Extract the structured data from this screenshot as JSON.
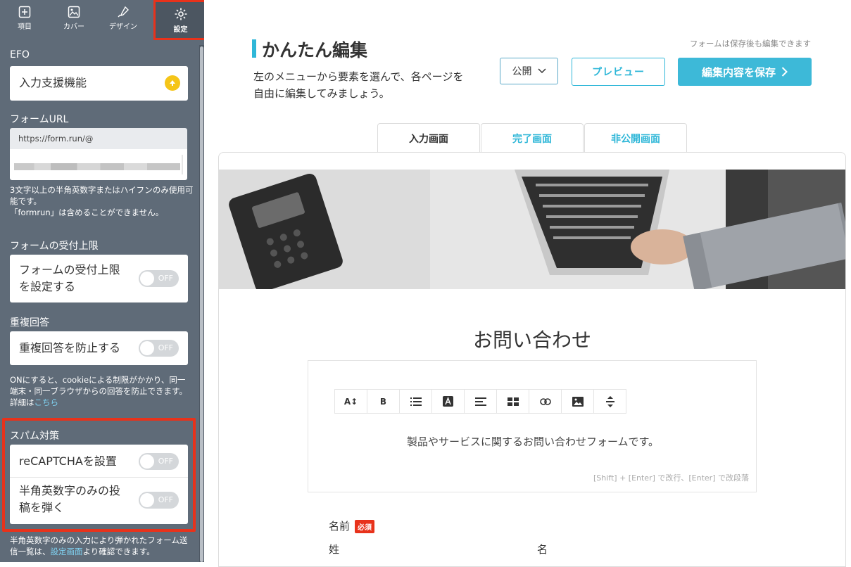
{
  "sidebar": {
    "tabs": [
      {
        "label": "項目",
        "icon": "plus-square-icon"
      },
      {
        "label": "カバー",
        "icon": "image-icon"
      },
      {
        "label": "デザイン",
        "icon": "brush-icon"
      },
      {
        "label": "設定",
        "icon": "gear-icon"
      }
    ],
    "efo": {
      "heading": "EFO",
      "card_label": "入力支援機能"
    },
    "url": {
      "heading": "フォームURL",
      "prefix": "https://form.run/@",
      "note_line1": "3文字以上の半角英数字またはハイフンのみ使用可能です。",
      "note_line2": "「formrun」は含めることができません。"
    },
    "limit": {
      "heading": "フォームの受付上限",
      "label_line1": "フォームの受付上限",
      "label_line2": "を設定する",
      "toggle": "OFF"
    },
    "duplicate": {
      "heading": "重複回答",
      "label": "重複回答を防止する",
      "toggle": "OFF",
      "note": "ONにすると、cookieによる制限がかかり、同一端末・同一ブラウザからの回答を防止できます。詳細は",
      "note_link": "こちら"
    },
    "spam": {
      "heading": "スパム対策",
      "recaptcha_label": "reCAPTCHAを設置",
      "recaptcha_toggle": "OFF",
      "alnum_line1": "半角英数字のみの投",
      "alnum_line2": "稿を弾く",
      "alnum_toggle": "OFF",
      "note_pre": "半角英数字のみの入力により弾かれたフォーム送信一覧は、",
      "note_link": "設定画面",
      "note_post": "より確認できます。"
    }
  },
  "header": {
    "title": "かんたん編集",
    "desc_line1": "左のメニューから要素を選んで、各ページを",
    "desc_line2": "自由に編集してみましょう。",
    "save_note": "フォームは保存後も編集できます",
    "visibility": "公開",
    "preview_label": "プレビュー",
    "save_label": "編集内容を保存"
  },
  "page_tabs": [
    {
      "label": "入力画面"
    },
    {
      "label": "完了画面"
    },
    {
      "label": "非公開画面"
    }
  ],
  "form": {
    "title": "お問い合わせ",
    "toolbar": [
      "A↕",
      "B",
      "list",
      "A",
      "align",
      "table",
      "link",
      "image",
      "spacing"
    ],
    "description": "製品やサービスに関するお問い合わせフォームです。",
    "hint": "[Shift] + [Enter] で改行、[Enter] で改段落",
    "name_label": "名前",
    "required": "必須",
    "last_name": "姓",
    "first_name": "名"
  },
  "colors": {
    "accent": "#3db9d8",
    "sidebar": "#5f6b78",
    "highlight": "#e8321b"
  }
}
